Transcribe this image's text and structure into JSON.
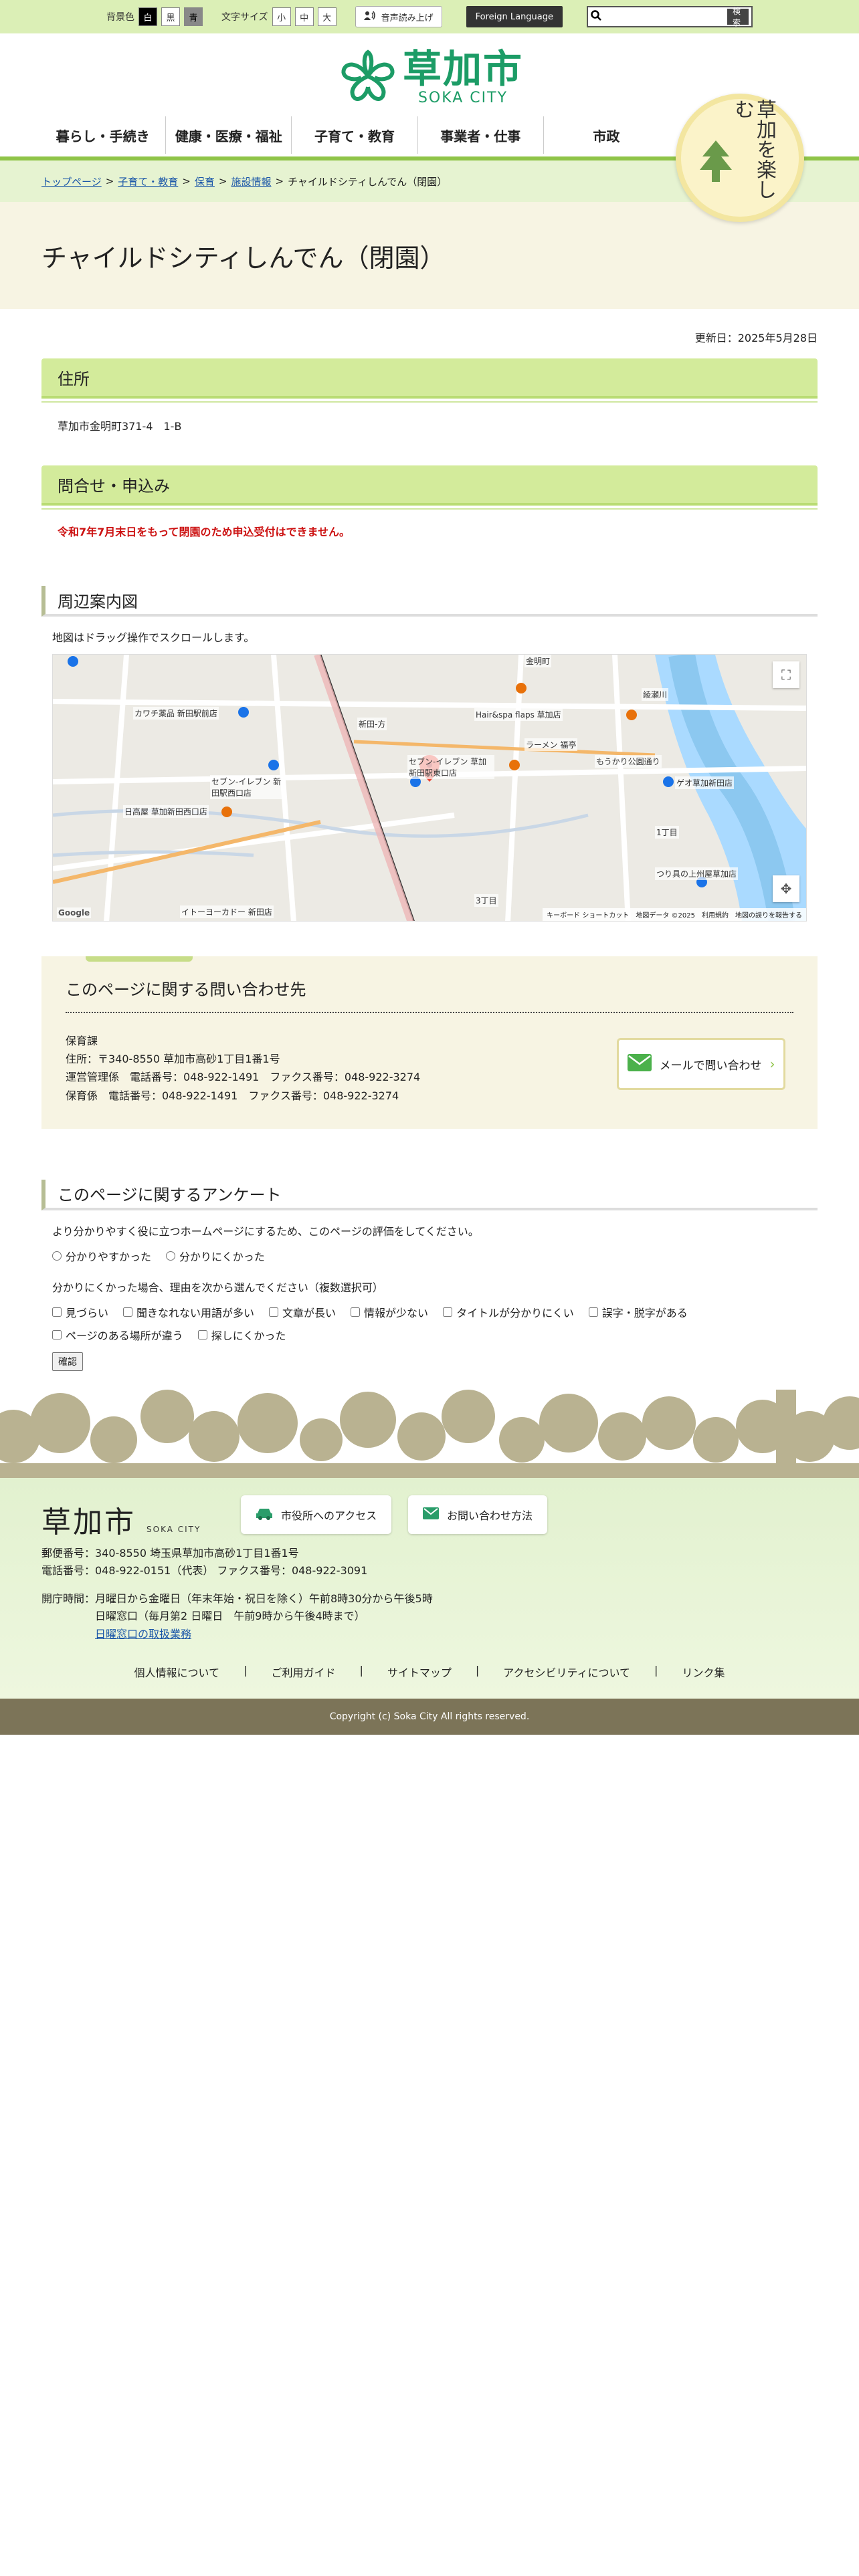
{
  "util": {
    "bg_label": "背景色",
    "bg_options": [
      "白",
      "黒",
      "青"
    ],
    "text_size_label": "文字サイズ",
    "text_size_options": [
      "小",
      "中",
      "大"
    ],
    "read_aloud": "音声読み上げ",
    "foreign_language": "Foreign Language",
    "search_placeholder": "",
    "search_button": "検索"
  },
  "header": {
    "logo_jp": "草加市",
    "logo_en": "SOKA CITY",
    "nav": [
      "暮らし・手続き",
      "健康・医療・福祉",
      "子育て・教育",
      "事業者・仕事",
      "市政"
    ],
    "badge_text": "草加を楽しむ"
  },
  "breadcrumb": {
    "items": [
      "トップページ",
      "子育て・教育",
      "保育",
      "施設情報"
    ],
    "separator": ">",
    "current": "チャイルドシティしんでん（閉園）"
  },
  "page": {
    "title": "チャイルドシティしんでん（閉園）",
    "updated": "更新日：2025年5月28日",
    "address_heading": "住所",
    "address": "草加市金明町371-4　1-B",
    "inquiry_heading": "問合せ・申込み",
    "inquiry_notice": "令和7年7月末日をもって閉園のため申込受付はできません。",
    "map_heading": "周辺案内図",
    "map_note": "地図はドラッグ操作でスクロールします。"
  },
  "map": {
    "labels": [
      "新田-方",
      "金明町",
      "Hair&spa flaps 草加店",
      "セブン-イレブン 草加新田駅東口店",
      "ラーメン 福亭",
      "日高屋 草加新田西口店",
      "セブン-イレブン 新田駅西口店",
      "カワチ薬品 新田駅前店",
      "イトーヨーカドー 新田店",
      "もうかり公園通り",
      "ゲオ草加新田店",
      "つり具の上州屋草加店",
      "1丁目",
      "3丁目",
      "綾瀬川",
      "Google"
    ],
    "footer": [
      "キーボード ショートカット",
      "地図データ ©2025",
      "利用規約",
      "地図の誤りを報告する"
    ]
  },
  "contact": {
    "heading": "このページに関する問い合わせ先",
    "department": "保育課",
    "address": "住所：〒340-8550 草加市高砂1丁目1番1号",
    "line1": "運営管理係　電話番号：048-922-1491　ファクス番号：048-922-3274",
    "line2": "保育係　電話番号：048-922-1491　ファクス番号：048-922-3274",
    "mail_button": "メールで問い合わせ"
  },
  "survey": {
    "heading": "このページに関するアンケート",
    "question1": "より分かりやすく役に立つホームページにするため、このページの評価をしてください。",
    "radio_options": [
      "分かりやすかった",
      "分かりにくかった"
    ],
    "question2": "分かりにくかった場合、理由を次から選んでください（複数選択可）",
    "check_options": [
      "見づらい",
      "聞きなれない用語が多い",
      "文章が長い",
      "情報が少ない",
      "タイトルが分かりにくい",
      "誤字・脱字がある",
      "ページのある場所が違う",
      "探しにくかった"
    ],
    "confirm": "確認"
  },
  "footer": {
    "logo_jp": "草加市",
    "logo_en": "SOKA CITY",
    "access_button": "市役所へのアクセス",
    "contact_button": "お問い合わせ方法",
    "postal": "郵便番号：340-8550 埼玉県草加市高砂1丁目1番1号",
    "phone": "電話番号：048-922-0151（代表）  ファクス番号：048-922-3091",
    "hours1": "開庁時間：月曜日から金曜日（年末年始・祝日を除く）午前8時30分から午後5時",
    "hours2": "日曜窓口（毎月第2 日曜日　午前9時から午後4時まで）",
    "hours_link": "日曜窓口の取扱業務",
    "links": [
      "個人情報について",
      "ご利用ガイド",
      "サイトマップ",
      "アクセシビリティについて",
      "リンク集"
    ],
    "copyright": "Copyright (c) Soka City All rights reserved."
  },
  "colors": {
    "accent_green": "#1c9c66",
    "heading_bg": "#d3eb9b",
    "notice_red": "#cc1111",
    "footer_bar": "#7c7458"
  }
}
